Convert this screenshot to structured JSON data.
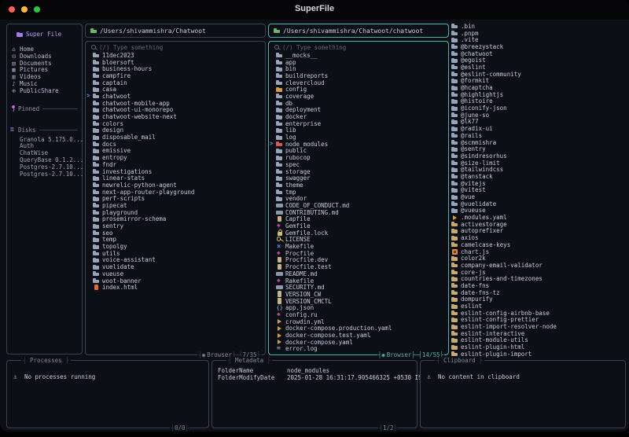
{
  "window": {
    "title": "SuperFile"
  },
  "colors": {
    "background": "#0d0f17",
    "border": "#3a4152",
    "active_border": "#45b5a9",
    "text": "#c6cbdc",
    "dim_text": "#5e6675",
    "folder": "#97a3bb",
    "cursor_blue": "#3f8fe8",
    "header_folder_green": "#67b86b",
    "sidebar_purple": "#b79af2",
    "node_modules_red": "#d95757",
    "npm_folder_tan": "#c9a96d",
    "amber": "#d79a43",
    "gem_magenta": "#c0418f",
    "yellow": "#d7c05e",
    "html_orange": "#e06836"
  },
  "sidebar": {
    "title": "Super File",
    "items": [
      {
        "label": "Home",
        "icon": "home"
      },
      {
        "label": "Downloads",
        "icon": "downloads"
      },
      {
        "label": "Documents",
        "icon": "documents"
      },
      {
        "label": "Pictures",
        "icon": "pictures"
      },
      {
        "label": "Videos",
        "icon": "videos"
      },
      {
        "label": "Music",
        "icon": "music"
      },
      {
        "label": "PublicShare",
        "icon": "public-share"
      }
    ],
    "pinned_label": "Pinned",
    "disks_label": "Disks",
    "disks": [
      "Granola 5.175.0...",
      "Auth",
      "ChatWise",
      "QueryBase 0.1.2...",
      "Postgres-2.7.10...",
      "Postgres-2.7.10..."
    ]
  },
  "panels": [
    {
      "path": "/Users/shivammishra/Chatwoot",
      "search_placeholder": "(/) Type something",
      "footer": {
        "mode": "Browser",
        "count": "7/35"
      },
      "active": false,
      "files": [
        {
          "n": "11dec2023"
        },
        {
          "n": "bloersoft"
        },
        {
          "n": "business-hours"
        },
        {
          "n": "campfire"
        },
        {
          "n": "captain"
        },
        {
          "n": "casa"
        },
        {
          "n": "chatwoot",
          "cur": true
        },
        {
          "n": "chatwoot-mobile-app"
        },
        {
          "n": "chatwoot-ui-monorepo"
        },
        {
          "n": "chatwoot-website-next"
        },
        {
          "n": "colors"
        },
        {
          "n": "design"
        },
        {
          "n": "disposable_mail"
        },
        {
          "n": "docs"
        },
        {
          "n": "emissive"
        },
        {
          "n": "entropy"
        },
        {
          "n": "fndr"
        },
        {
          "n": "investigations"
        },
        {
          "n": "linear-stats"
        },
        {
          "n": "newrelic-python-agent"
        },
        {
          "n": "next-app-router-playground"
        },
        {
          "n": "perf-scripts"
        },
        {
          "n": "pipecat"
        },
        {
          "n": "playground"
        },
        {
          "n": "prosemirror-schema"
        },
        {
          "n": "sentry"
        },
        {
          "n": "seo"
        },
        {
          "n": "temp"
        },
        {
          "n": "topolgy"
        },
        {
          "n": "utils"
        },
        {
          "n": "voice-assistant"
        },
        {
          "n": "vuelidate"
        },
        {
          "n": "vueuse"
        },
        {
          "n": "woot-banner"
        },
        {
          "n": "index.html",
          "i": "file",
          "c": "#e06836"
        }
      ]
    },
    {
      "path": "/Users/shivammishra/Chatwoot/chatwoot",
      "search_placeholder": "(/) Type something",
      "footer": {
        "mode": "Browser",
        "count": "14/55"
      },
      "active": true,
      "files": [
        {
          "n": "__mocks__"
        },
        {
          "n": "app"
        },
        {
          "n": "bin"
        },
        {
          "n": "buildreports"
        },
        {
          "n": "clevercloud"
        },
        {
          "n": "config",
          "c": "#d79a43"
        },
        {
          "n": "coverage"
        },
        {
          "n": "db"
        },
        {
          "n": "deployment"
        },
        {
          "n": "docker"
        },
        {
          "n": "enterprise"
        },
        {
          "n": "lib"
        },
        {
          "n": "log"
        },
        {
          "n": "node_modules",
          "c": "#d95757",
          "cur": true
        },
        {
          "n": "public"
        },
        {
          "n": "rubocop"
        },
        {
          "n": "spec"
        },
        {
          "n": "storage"
        },
        {
          "n": "swagger"
        },
        {
          "n": "theme"
        },
        {
          "n": "tmp"
        },
        {
          "n": "vendor"
        },
        {
          "n": "CODE_OF_CONDUCT.md",
          "i": "md"
        },
        {
          "n": "CONTRIBUTING.md",
          "i": "md"
        },
        {
          "n": "Capfile",
          "i": "file"
        },
        {
          "n": "Gemfile",
          "i": "gem"
        },
        {
          "n": "Gemfile.lock",
          "i": "lock"
        },
        {
          "n": "LICENSE",
          "i": "key"
        },
        {
          "n": "Makefile",
          "i": "make"
        },
        {
          "n": "Procfile",
          "i": "gem"
        },
        {
          "n": "Procfile.dev",
          "i": "file"
        },
        {
          "n": "Procfile.test",
          "i": "file"
        },
        {
          "n": "README.md",
          "i": "md"
        },
        {
          "n": "Rakefile",
          "i": "gem"
        },
        {
          "n": "SECURITY.md",
          "i": "md"
        },
        {
          "n": "VERSION_CW",
          "i": "file"
        },
        {
          "n": "VERSION_CMCTL",
          "i": "file"
        },
        {
          "n": "app.json",
          "i": "json"
        },
        {
          "n": "config.ru",
          "i": "gem"
        },
        {
          "n": "crowdin.yml",
          "i": "yaml"
        },
        {
          "n": "docker-compose.production.yaml",
          "i": "yaml"
        },
        {
          "n": "docker-compose.test.yaml",
          "i": "yaml"
        },
        {
          "n": "docker-compose.yaml",
          "i": "yaml"
        },
        {
          "n": "error.log",
          "i": "log"
        }
      ]
    }
  ],
  "preview": {
    "files": [
      {
        "n": ".bin"
      },
      {
        "n": ".pnpm"
      },
      {
        "n": ".vite"
      },
      {
        "n": "@breezystack"
      },
      {
        "n": "@chatwoot"
      },
      {
        "n": "@egoist"
      },
      {
        "n": "@eslint"
      },
      {
        "n": "@eslint-community"
      },
      {
        "n": "@formkit"
      },
      {
        "n": "@hcaptcha"
      },
      {
        "n": "@highlightjs"
      },
      {
        "n": "@histoire"
      },
      {
        "n": "@iconify-json"
      },
      {
        "n": "@june-so"
      },
      {
        "n": "@lk77"
      },
      {
        "n": "@radix-ui"
      },
      {
        "n": "@rails"
      },
      {
        "n": "@scmmishra"
      },
      {
        "n": "@sentry"
      },
      {
        "n": "@sindresorhus"
      },
      {
        "n": "@size-limit"
      },
      {
        "n": "@tailwindcss"
      },
      {
        "n": "@tanstack"
      },
      {
        "n": "@vitejs"
      },
      {
        "n": "@vitest"
      },
      {
        "n": "@vue"
      },
      {
        "n": "@vuelidate"
      },
      {
        "n": "@vueuse"
      },
      {
        "n": ".modules.yaml",
        "i": "yaml"
      },
      {
        "n": "activestorage",
        "c": "#c9a96d"
      },
      {
        "n": "autoprefixer",
        "c": "#c9a96d"
      },
      {
        "n": "axios",
        "c": "#c9a96d"
      },
      {
        "n": "camelcase-keys",
        "c": "#c9a96d"
      },
      {
        "n": "chart.js",
        "i": "chart"
      },
      {
        "n": "color2k",
        "c": "#c9a96d"
      },
      {
        "n": "company-email-validator",
        "c": "#c9a96d"
      },
      {
        "n": "core-js",
        "c": "#c9a96d"
      },
      {
        "n": "countries-and-timezones",
        "c": "#c9a96d"
      },
      {
        "n": "date-fns",
        "c": "#c9a96d"
      },
      {
        "n": "date-fns-tz",
        "c": "#c9a96d"
      },
      {
        "n": "dompurify",
        "c": "#c9a96d"
      },
      {
        "n": "eslint",
        "c": "#c9a96d"
      },
      {
        "n": "eslint-config-airbnb-base",
        "c": "#c9a96d"
      },
      {
        "n": "eslint-config-prettier",
        "c": "#c9a96d"
      },
      {
        "n": "eslint-import-resolver-node",
        "c": "#c9a96d"
      },
      {
        "n": "eslint-interactive",
        "c": "#c9a96d"
      },
      {
        "n": "eslint-module-utils",
        "c": "#c9a96d"
      },
      {
        "n": "eslint-plugin-html",
        "c": "#c9a96d"
      },
      {
        "n": "eslint-plugin-import",
        "c": "#c9a96d"
      }
    ]
  },
  "bottom": {
    "processes": {
      "title": "Processes",
      "empty": "No processes running",
      "count": "0/0"
    },
    "metadata": {
      "title": "Metadata",
      "rows": [
        [
          "FolderName",
          "node_modules"
        ],
        [
          "FolderModifyDate",
          "2025-01-28 16:31:17.905466325 +0530 IST"
        ]
      ],
      "count": "1/2"
    },
    "clipboard": {
      "title": "Clipboard",
      "empty": "No content in clipboard"
    }
  }
}
